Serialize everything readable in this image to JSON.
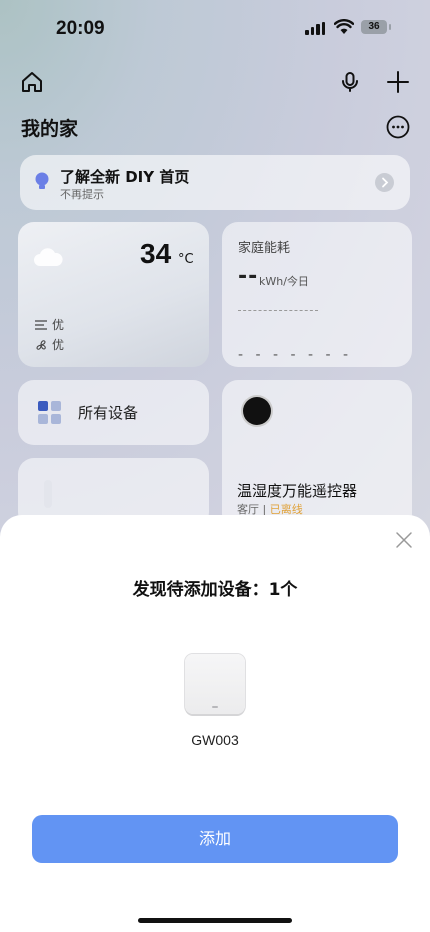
{
  "status": {
    "time": "20:09",
    "battery": "36"
  },
  "header": {
    "title": "我的家"
  },
  "tip": {
    "title": "了解全新 DIY 首页",
    "subtitle": "不再提示"
  },
  "weather": {
    "temperature": "34",
    "unit": "°C",
    "air": "优",
    "wind": "优"
  },
  "energy": {
    "title": "家庭能耗",
    "value": "--",
    "unit": "kWh/今日",
    "placeholder": "- - - - - - -"
  },
  "devices": {
    "label": "所有设备"
  },
  "remote": {
    "name": "温湿度万能遥控器",
    "room": "客厅",
    "separator": " | ",
    "status": "已离线"
  },
  "sheet": {
    "title": "发现待添加设备：1个",
    "device_name": "GW003",
    "add_button": "添加"
  },
  "colors": {
    "accent": "#6294f3",
    "offline": "#e0a23a"
  }
}
